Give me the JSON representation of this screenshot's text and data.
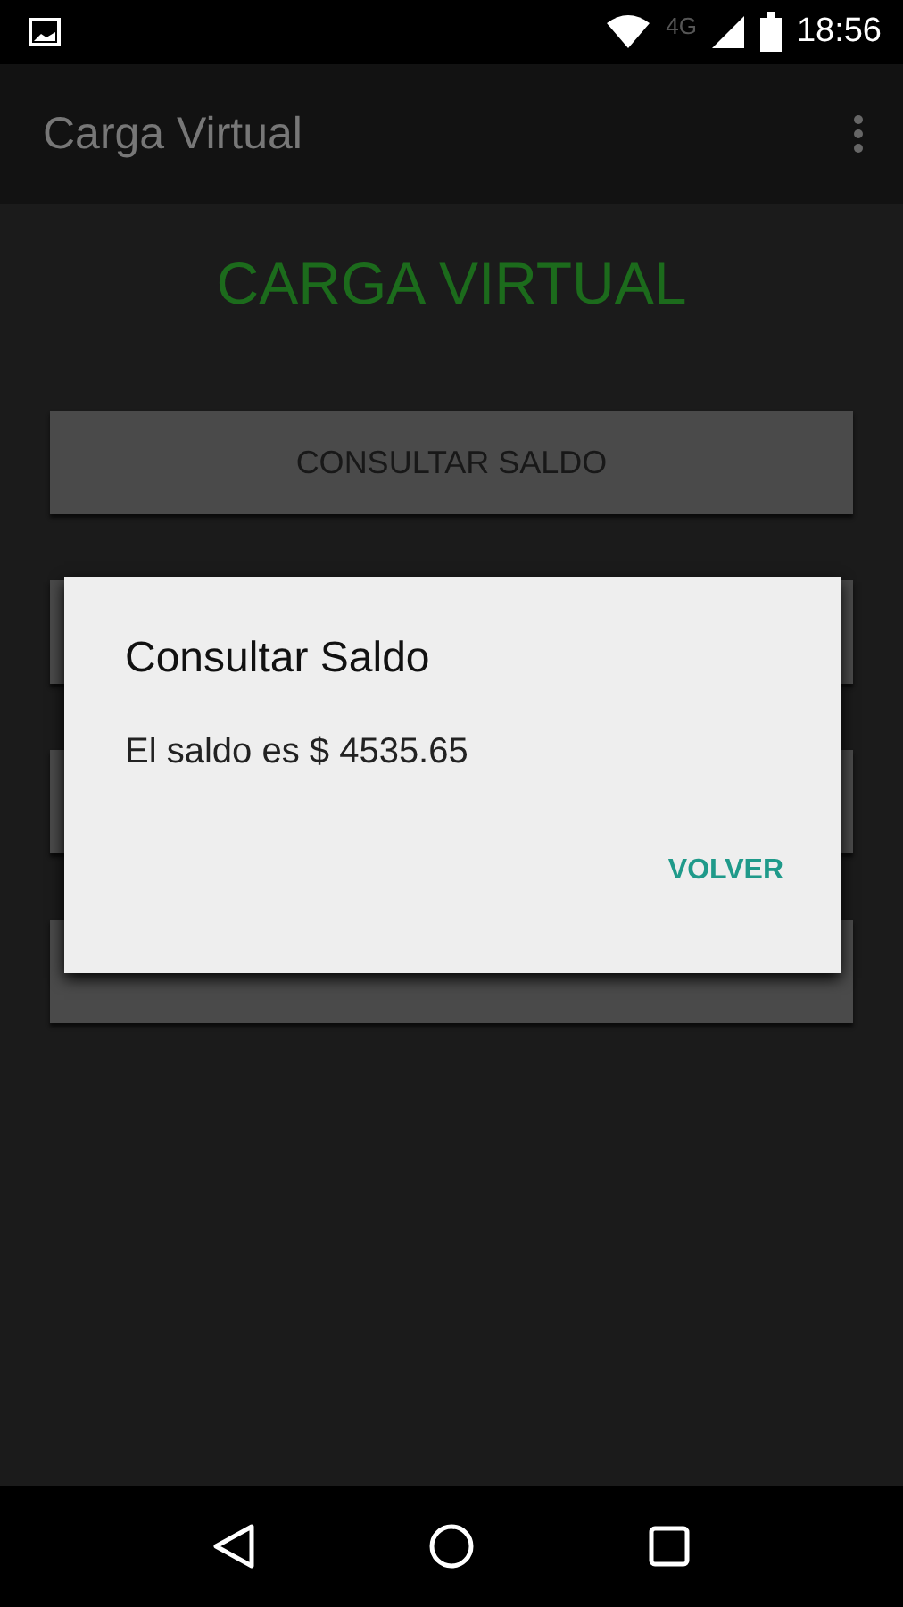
{
  "status_bar": {
    "network": "4G",
    "time": "18:56"
  },
  "app_bar": {
    "title": "Carga Virtual"
  },
  "heading": "CARGA VIRTUAL",
  "buttons": [
    {
      "kind": "labeled",
      "label": "CONSULTAR SALDO"
    },
    {
      "kind": "covered"
    },
    {
      "kind": "covered"
    },
    {
      "kind": "covered"
    }
  ],
  "dialog": {
    "title": "Consultar Saldo",
    "message": "El saldo es $ 4535.65",
    "action": "VOLVER"
  }
}
